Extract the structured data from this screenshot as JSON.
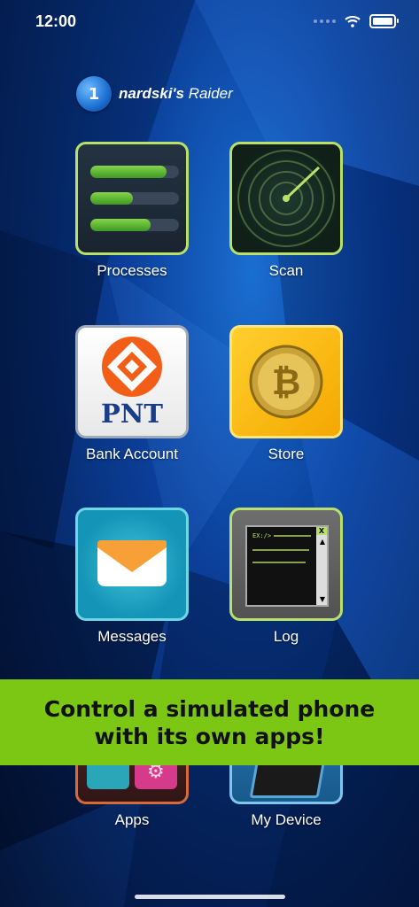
{
  "status_bar": {
    "time": "12:00"
  },
  "brand": {
    "badge": "1",
    "name_bold": "nardski's",
    "name_rest": "Raider"
  },
  "apps": [
    {
      "label": "Processes"
    },
    {
      "label": "Scan"
    },
    {
      "label": "Bank Account",
      "logo_text": "PNT"
    },
    {
      "label": "Store"
    },
    {
      "label": "Messages"
    },
    {
      "label": "Log",
      "log_close": "X",
      "log_prompt": "EX:/>"
    },
    {
      "label": "Apps"
    },
    {
      "label": "My Device"
    }
  ],
  "banner": {
    "line1": "Control a simulated phone",
    "line2": "with its own apps!"
  },
  "colors": {
    "banner": "#7cc614",
    "accent_green": "#b9e069",
    "background": "#0b3f9a"
  }
}
